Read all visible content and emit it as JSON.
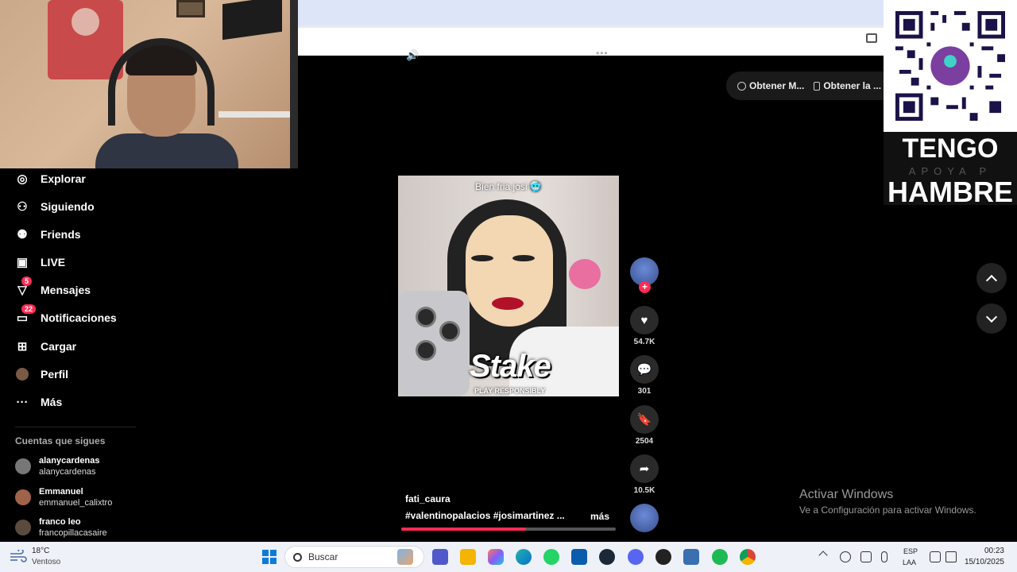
{
  "qr_overlay": {
    "tengo": "TENGO",
    "apoya": "APOYA P",
    "hambre": "HAMBRE"
  },
  "app_buttons": {
    "desktop": "Obtener M...",
    "mobile": "Obtener la ..."
  },
  "sidebar": {
    "items": [
      {
        "label": "Explorar",
        "icon": "compass-icon"
      },
      {
        "label": "Siguiendo",
        "icon": "user-follow-icon"
      },
      {
        "label": "Friends",
        "icon": "friends-icon"
      },
      {
        "label": "LIVE",
        "icon": "live-tv-icon"
      },
      {
        "label": "Mensajes",
        "icon": "send-icon",
        "badge": "5"
      },
      {
        "label": "Notificaciones",
        "icon": "inbox-icon",
        "badge": "22"
      },
      {
        "label": "Cargar",
        "icon": "upload-plus-icon"
      },
      {
        "label": "Perfil",
        "icon": "profile-avatar-icon"
      },
      {
        "label": "Más",
        "icon": "more-dots-icon"
      }
    ],
    "following_title": "Cuentas que sigues",
    "accounts": [
      {
        "name": "alanycardenas",
        "handle": "alanycardenas"
      },
      {
        "name": "Emmanuel",
        "handle": "emmanuel_calixtro"
      },
      {
        "name": "franco leo",
        "handle": "francopillacasaire"
      }
    ]
  },
  "video": {
    "caption": "Bien fria josi 🥶",
    "brand": "Stake",
    "brand_sub": "PLAY RESPONSIBLY",
    "author": "fati_caura",
    "tags": "#valentinopalacios  #josimartinez  ...",
    "more": "más",
    "progress": 0.58
  },
  "actions": {
    "likes": "54.7K",
    "comments": "301",
    "saves": "2504",
    "shares": "10.5K"
  },
  "activate_windows": {
    "title": "Activar Windows",
    "subtitle": "Ve a Configuración para activar Windows."
  },
  "taskbar": {
    "weather_temp": "18°C",
    "weather_desc": "Ventoso",
    "search_placeholder": "Buscar",
    "lang_1": "ESP",
    "lang_2": "LAA",
    "time": "00:23",
    "date": "15/10/2025"
  },
  "colors": {
    "accent": "#fe2c55",
    "background": "#000000",
    "taskbar": "#eef1f7"
  }
}
